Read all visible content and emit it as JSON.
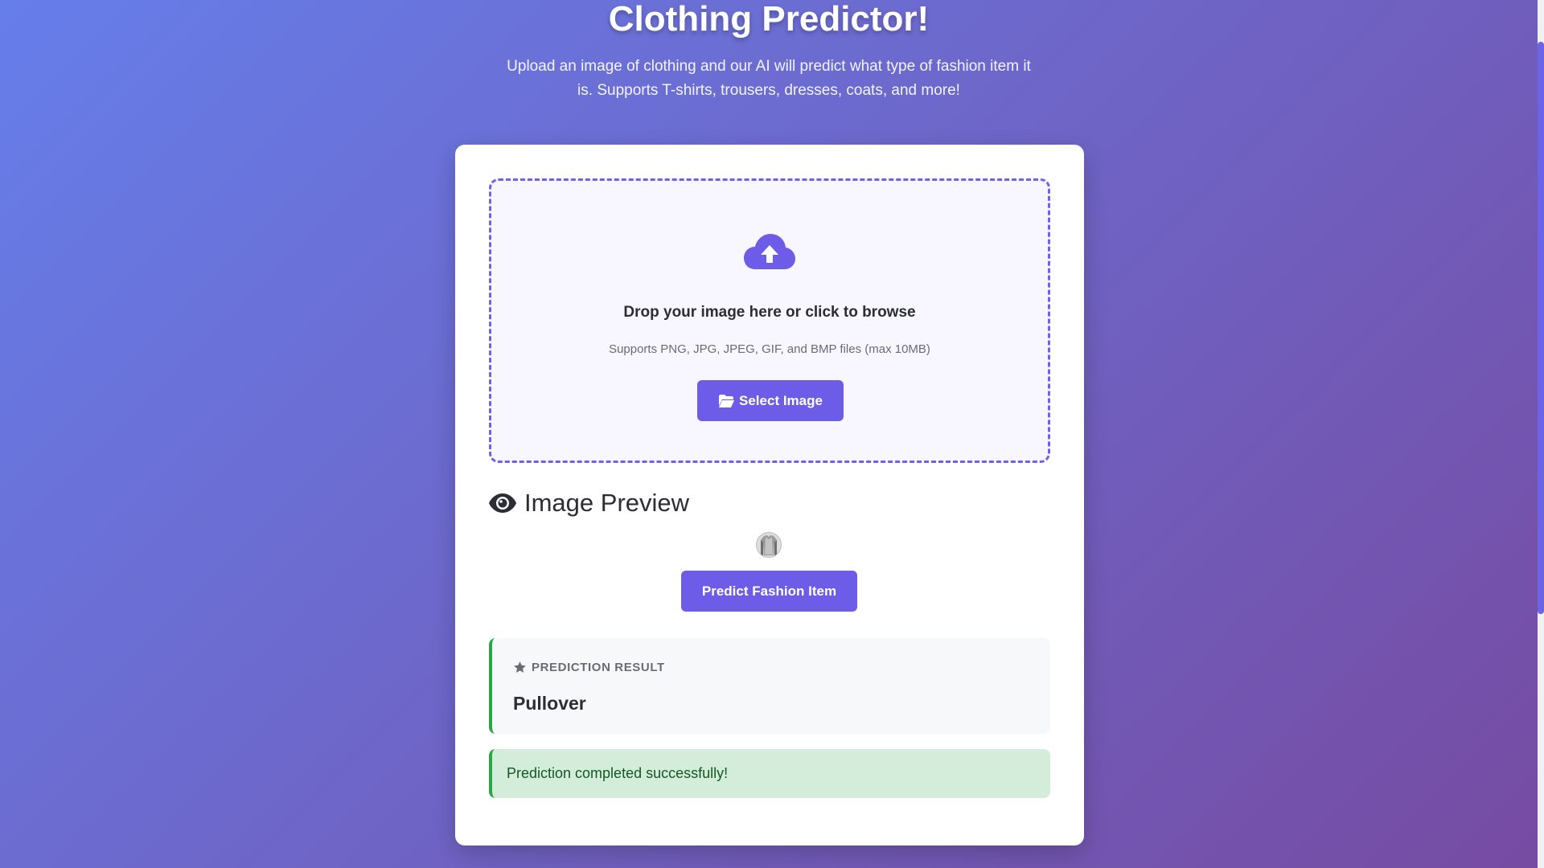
{
  "header": {
    "title": "Clothing Predictor!",
    "subtitle": "Upload an image of clothing and our AI will predict what type of fashion item it is. Supports T-shirts, trousers, dresses, coats, and more!"
  },
  "upload": {
    "icon": "cloud-upload-icon",
    "drop_text": "Drop your image here or click to browse",
    "supports_text": "Supports PNG, JPG, JPEG, GIF, and BMP files (max 10MB)",
    "select_button_label": "Select Image",
    "select_button_icon": "folder-open-icon"
  },
  "preview": {
    "heading": "Image Preview",
    "heading_icon": "eye-icon",
    "thumbnail": "pullover-thumbnail",
    "predict_button_label": "Predict Fashion Item"
  },
  "result": {
    "label": "PREDICTION RESULT",
    "label_icon": "star-icon",
    "value": "Pullover"
  },
  "status": {
    "message": "Prediction completed successfully!"
  },
  "colors": {
    "gradient_start": "#667eea",
    "gradient_end": "#764ba2",
    "accent": "#6c5ce7",
    "success": "#28a745",
    "success_bg": "#d4edda"
  }
}
